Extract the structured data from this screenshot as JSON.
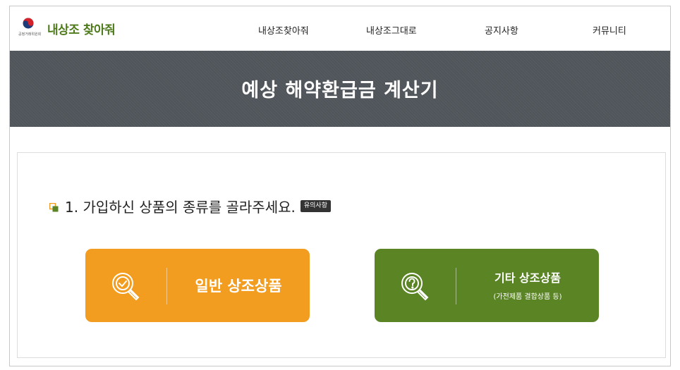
{
  "header": {
    "logo_text": "내상조 찾아줘",
    "agency_text": "공정거래위원회",
    "nav": [
      "내상조찾아줘",
      "내상조그대로",
      "공지사항",
      "커뮤니티"
    ]
  },
  "banner": {
    "title": "예상 해약환급금 계산기"
  },
  "question": {
    "text": "1. 가입하신 상품의 종류를 골라주세요.",
    "notice_label": "유의사항"
  },
  "products": [
    {
      "title": "일반 상조상품",
      "subtitle": "",
      "icon": "search-check-icon"
    },
    {
      "title": "기타 상조상품",
      "subtitle": "(가전제품 결합상품 등)",
      "icon": "search-question-icon"
    }
  ],
  "colors": {
    "brand_green": "#4e7a1c",
    "banner": "#50555b",
    "orange": "#f29d20",
    "green": "#5b8425"
  }
}
